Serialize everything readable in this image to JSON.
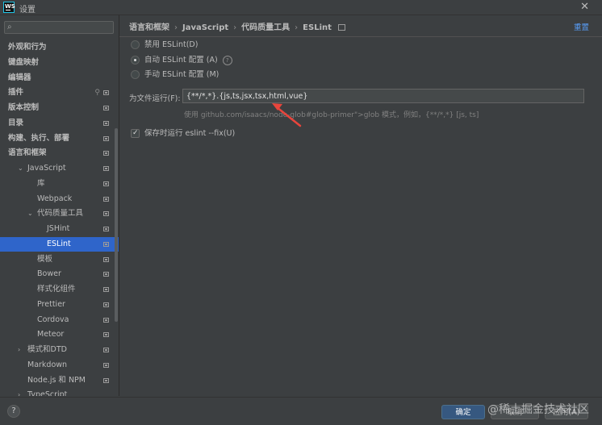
{
  "window": {
    "title": "设置",
    "logo_text": "WS"
  },
  "search": {
    "value": "",
    "placeholder": ""
  },
  "sidebar": {
    "items": [
      {
        "label": "外观和行为",
        "arrow": "›",
        "level": 0
      },
      {
        "label": "键盘映射",
        "arrow": "",
        "level": 0
      },
      {
        "label": "编辑器",
        "arrow": "›",
        "level": 0
      },
      {
        "label": "插件",
        "arrow": "",
        "level": 0,
        "has_plugin_icon": true
      },
      {
        "label": "版本控制",
        "arrow": "›",
        "level": 0
      },
      {
        "label": "目录",
        "arrow": "",
        "level": 0
      },
      {
        "label": "构建、执行、部署",
        "arrow": "›",
        "level": 0
      },
      {
        "label": "语言和框架",
        "arrow": "⌄",
        "level": 0
      },
      {
        "label": "JavaScript",
        "arrow": "⌄",
        "level": 1
      },
      {
        "label": "库",
        "arrow": "",
        "level": 2
      },
      {
        "label": "Webpack",
        "arrow": "",
        "level": 2
      },
      {
        "label": "代码质量工具",
        "arrow": "⌄",
        "level": 2
      },
      {
        "label": "JSHint",
        "arrow": "",
        "level": 3
      },
      {
        "label": "ESLint",
        "arrow": "",
        "level": 3,
        "selected": true
      },
      {
        "label": "模板",
        "arrow": "",
        "level": 2
      },
      {
        "label": "Bower",
        "arrow": "",
        "level": 2
      },
      {
        "label": "样式化组件",
        "arrow": "",
        "level": 2
      },
      {
        "label": "Prettier",
        "arrow": "",
        "level": 2
      },
      {
        "label": "Cordova",
        "arrow": "",
        "level": 2
      },
      {
        "label": "Meteor",
        "arrow": "",
        "level": 2
      },
      {
        "label": "模式和DTD",
        "arrow": "›",
        "level": 1
      },
      {
        "label": "Markdown",
        "arrow": "",
        "level": 1
      },
      {
        "label": "Node.js 和 NPM",
        "arrow": "",
        "level": 1
      },
      {
        "label": "TypeScript",
        "arrow": "›",
        "level": 1
      }
    ]
  },
  "breadcrumb": {
    "items": [
      "语言和框架",
      "JavaScript",
      "代码质量工具",
      "ESLint"
    ],
    "separator": "›"
  },
  "reset_link": "重置",
  "eslint": {
    "options": [
      {
        "label": "禁用 ESLint(D)",
        "checked": false
      },
      {
        "label": "自动 ESLint 配置 (A)",
        "checked": true,
        "help": true
      },
      {
        "label": "手动 ESLint 配置 (M)",
        "checked": false
      }
    ],
    "run_for_label": "为文件运行(F):",
    "run_for_value": "{**/*,*}.{js,ts,jsx,tsx,html,vue}",
    "hint": "使用 github.com/isaacs/node-glob#glob-primer\">glob 模式，例如，{**/*,*}  [js, ts]",
    "fix_on_save_label": "保存时运行 eslint --fix(U)",
    "fix_on_save_checked": true
  },
  "buttons": {
    "ok": "确定",
    "cancel": "取消",
    "apply": "应用(A)",
    "help": "?"
  },
  "watermark": "@稀土掘金技术社区",
  "colors": {
    "selection": "#2f65ca",
    "link": "#589df6",
    "annotation_arrow": "#e8453c"
  }
}
